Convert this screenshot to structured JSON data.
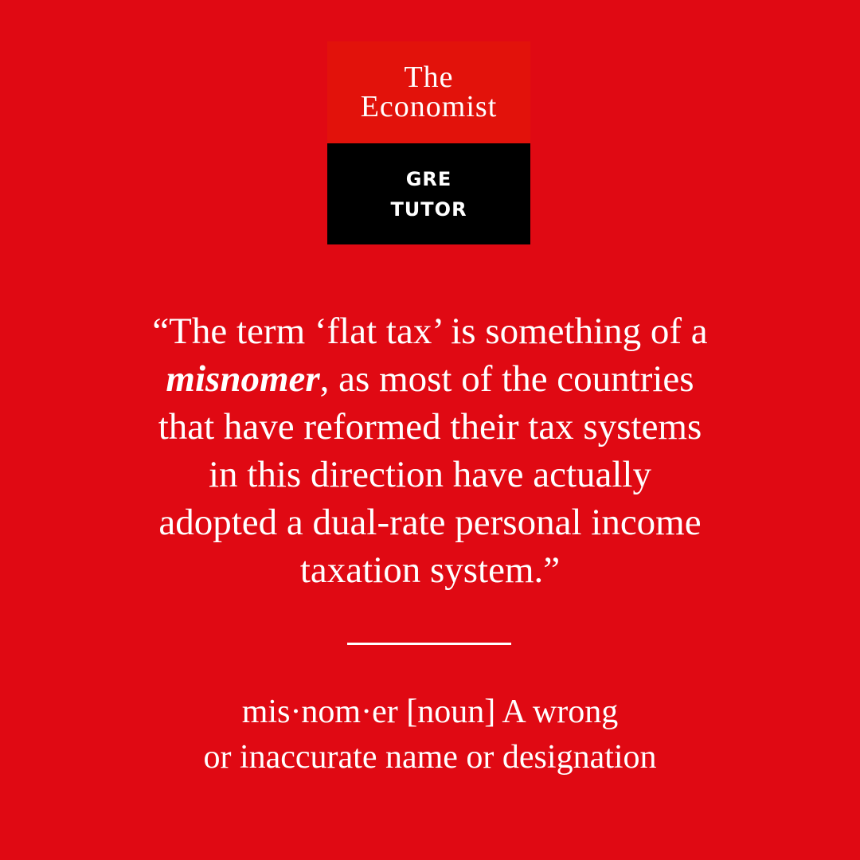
{
  "logo": {
    "title_line1": "The",
    "title_line2": "Economist",
    "sub_line1": "GRE",
    "sub_line2": "TUTOR"
  },
  "quote": {
    "line1": "“The term ‘flat tax’ is something of a",
    "line2_keyword": "misnomer",
    "line2_rest": ", as most of the countries",
    "line3": "that have reformed their tax systems",
    "line4": "in this direction have actually",
    "line5": "adopted a dual-rate personal income",
    "line6": "taxation system.”"
  },
  "definition": {
    "line1": "mis·nom·er [noun] A wrong",
    "line2": "or inaccurate name or designation"
  },
  "colors": {
    "background": "#e00913",
    "logo_top": "#e2120b",
    "logo_bottom": "#000000",
    "text": "#ffffff"
  }
}
